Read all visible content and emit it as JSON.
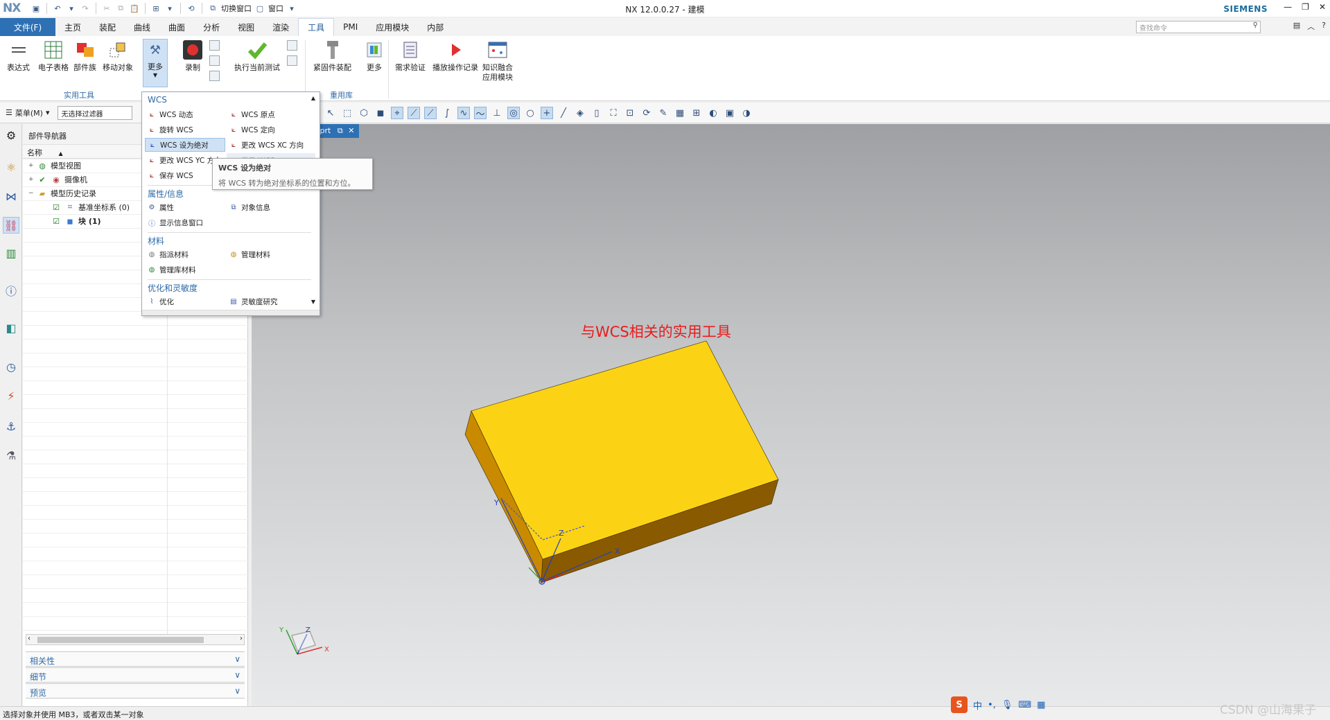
{
  "titlebar": {
    "logo": "NX",
    "title": "NX 12.0.0.27 - 建模",
    "brand": "SIEMENS",
    "switch_window": "切换窗口",
    "window_menu": "窗口"
  },
  "menubar": {
    "file": "文件(F)",
    "tabs": [
      "主页",
      "装配",
      "曲线",
      "曲面",
      "分析",
      "视图",
      "渲染",
      "工具",
      "PMI",
      "应用模块",
      "内部"
    ],
    "active_tab": "工具",
    "search_placeholder": "查找命令"
  },
  "ribbon": {
    "buttons": [
      "表达式",
      "电子表格",
      "部件族",
      "移动对象",
      "更多",
      "录制",
      "执行当前测试",
      "紧固件装配",
      "更多",
      "需求验证",
      "播放操作记录",
      "知识融合",
      "应用模块"
    ],
    "group_labels": [
      "实用工具",
      "重用库"
    ]
  },
  "toolbar": {
    "menu": "菜单(M)",
    "filter": "无选择过滤器"
  },
  "navigator": {
    "title": "部件导航器",
    "column_name": "名称",
    "tree": [
      {
        "label": "模型视图"
      },
      {
        "label": "摄像机"
      },
      {
        "label": "模型历史记录"
      },
      {
        "label": "基准坐标系 (0)"
      },
      {
        "label": "块 (1)"
      }
    ],
    "accordions": [
      "相关性",
      "细节",
      "预览"
    ]
  },
  "viewport": {
    "tab_suffix": ".prt",
    "annotation": "与WCS相关的实用工具",
    "axis_x": "X",
    "axis_y": "Y",
    "axis_z": "Z"
  },
  "dropdown": {
    "sections": [
      "WCS",
      "属性/信息",
      "材料",
      "优化和灵敏度"
    ],
    "wcs_items": [
      "WCS 动态",
      "WCS 原点",
      "旋转 WCS",
      "WCS 定向",
      "WCS 设为绝对",
      "更改 WCS XC 方向",
      "更改 WCS YC 方向",
      "显示 WCS",
      "保存 WCS"
    ],
    "info_items": [
      "属性",
      "对象信息",
      "显示信息窗口"
    ],
    "material_items": [
      "指派材料",
      "管理材料",
      "管理库材料"
    ],
    "opt_items": [
      "优化",
      "灵敏度研究"
    ]
  },
  "tooltip": {
    "title": "WCS 设为绝对",
    "desc": "将 WCS 转为绝对坐标系的位置和方位。"
  },
  "statusbar": {
    "text": "选择对象并使用 MB3，或者双击某一对象"
  },
  "ime": {
    "label": "中"
  },
  "watermark": "CSDN @山海果子",
  "colors": {
    "accent": "#2d71b4",
    "block_top": "#fcd314",
    "block_side": "#c98a00",
    "annotation": "#e81c1c"
  }
}
